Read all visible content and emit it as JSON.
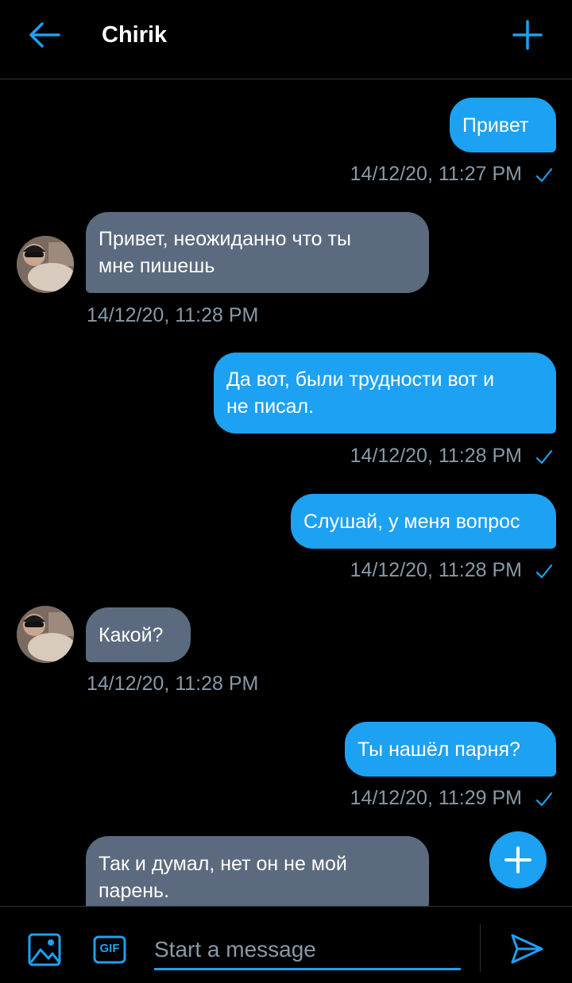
{
  "header": {
    "title": "Chirik",
    "back_icon": "arrow-left-icon",
    "new_icon": "plus-icon"
  },
  "colors": {
    "accent": "#1da1f2",
    "incoming_bubble": "#5b6a7e",
    "timestamp": "#8899a6",
    "background": "#000000"
  },
  "messages": [
    {
      "direction": "out",
      "lines": [
        "Привет"
      ],
      "time": "14/12/20, 11:27 PM",
      "read": true
    },
    {
      "direction": "in",
      "lines": [
        "Привет, неожиданно что ты",
        "мне пишешь"
      ],
      "time": "14/12/20, 11:28 PM"
    },
    {
      "direction": "out",
      "lines": [
        "Да вот, были трудности вот и",
        "не писал."
      ],
      "time": "14/12/20, 11:28 PM",
      "read": true
    },
    {
      "direction": "out",
      "lines": [
        "Слушай, у меня вопрос"
      ],
      "time": "14/12/20, 11:28 PM",
      "read": true
    },
    {
      "direction": "in",
      "lines": [
        "Какой?"
      ],
      "time": "14/12/20, 11:28 PM"
    },
    {
      "direction": "out",
      "lines": [
        "Ты нашёл парня?"
      ],
      "time": "14/12/20, 11:29 PM",
      "read": true
    },
    {
      "direction": "in",
      "lines": [
        "Так и думал, нет он не мой",
        "парень."
      ]
    }
  ],
  "composer": {
    "placeholder": "Start a message",
    "media_icon": "image-icon",
    "gif_label": "GIF",
    "send_icon": "send-icon"
  },
  "fab": {
    "icon": "plus-icon"
  }
}
